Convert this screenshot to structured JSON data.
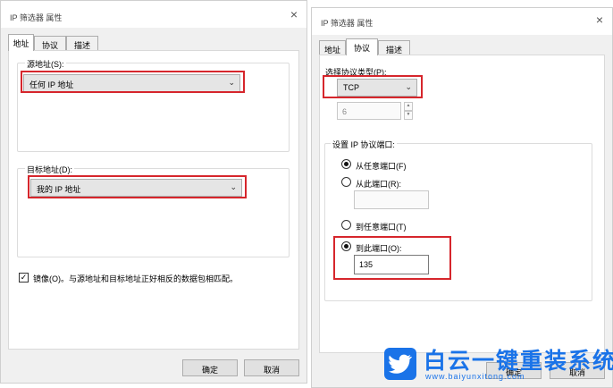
{
  "left_dialog": {
    "title": "IP 筛选器 属性",
    "close": "×",
    "tabs": [
      {
        "label": "地址",
        "active": true
      },
      {
        "label": "协议",
        "active": false
      },
      {
        "label": "描述",
        "active": false
      }
    ],
    "source": {
      "label": "源地址(S):",
      "value": "任何 IP 地址"
    },
    "destination": {
      "label": "目标地址(D):",
      "value": "我的 IP 地址"
    },
    "mirror": {
      "checked": true,
      "check_mark": "✓",
      "label": "镜像(O)。与源地址和目标地址正好相反的数据包相匹配。"
    },
    "buttons": {
      "ok": "确定",
      "cancel": "取消"
    }
  },
  "right_dialog": {
    "title": "IP 筛选器 属性",
    "close": "×",
    "tabs": [
      {
        "label": "地址",
        "active": false
      },
      {
        "label": "协议",
        "active": true
      },
      {
        "label": "描述",
        "active": false
      }
    ],
    "protocol_type": {
      "label": "选择协议类型(P):",
      "value": "TCP"
    },
    "protocol_number": "6",
    "port_group": {
      "label": "设置 IP 协议端口:",
      "from_any": {
        "label": "从任意端口(F)",
        "checked": true
      },
      "from_port": {
        "label": "从此端口(R):",
        "checked": false,
        "value": ""
      },
      "to_any": {
        "label": "到任意端口(T)",
        "checked": false
      },
      "to_port": {
        "label": "到此端口(O):",
        "checked": true,
        "value": "135"
      }
    },
    "buttons": {
      "ok": "确定",
      "cancel": "取消"
    }
  },
  "watermark": {
    "title": "白云一键重装系统",
    "url": "www.baiyunxitong.com"
  },
  "colors": {
    "highlight": "#d6262c",
    "watermark": "#1a73e8",
    "dialog_bg": "#f0f0f0"
  }
}
